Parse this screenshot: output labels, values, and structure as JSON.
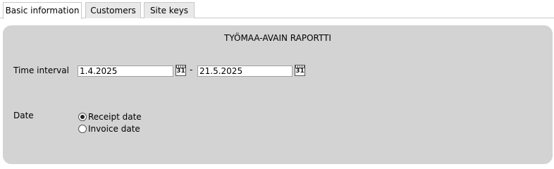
{
  "tabs": {
    "basic": "Basic information",
    "customers": "Customers",
    "site_keys": "Site keys",
    "active": "basic"
  },
  "report": {
    "title": "TYÖMAA-AVAIN RAPORTTI"
  },
  "time_interval": {
    "label": "Time interval",
    "start": "1.4.2025",
    "separator": "-",
    "end": "21.5.2025",
    "calendar_icon_text": "31"
  },
  "date_type": {
    "label": "Date",
    "options": [
      {
        "label": "Receipt date",
        "checked": true
      },
      {
        "label": "Invoice date",
        "checked": false
      }
    ]
  }
}
